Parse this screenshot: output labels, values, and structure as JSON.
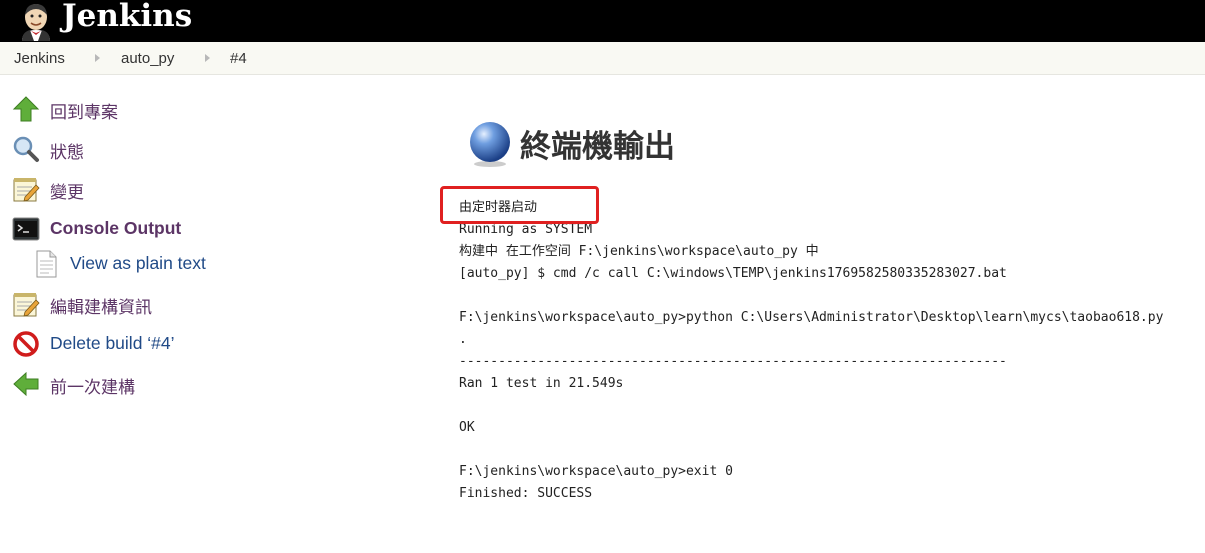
{
  "header": {
    "logo_text": "Jenkins",
    "logo_icon": "jenkins-butler-icon"
  },
  "breadcrumb": {
    "items": [
      "Jenkins",
      "auto_py",
      "#4"
    ]
  },
  "sidebar": {
    "items": [
      {
        "label": "回到專案",
        "icon": "up-arrow-icon"
      },
      {
        "label": "狀態",
        "icon": "search-icon"
      },
      {
        "label": "變更",
        "icon": "notepad-icon"
      },
      {
        "label": "Console Output",
        "icon": "terminal-icon"
      },
      {
        "label": "View as plain text",
        "icon": "document-icon"
      },
      {
        "label": "編輯建構資訊",
        "icon": "notepad-icon"
      },
      {
        "label": "Delete build ‘#4’",
        "icon": "no-entry-icon"
      },
      {
        "label": "前一次建構",
        "icon": "left-arrow-icon"
      }
    ]
  },
  "main": {
    "title": "終端機輸出",
    "title_icon": "blue-ball-icon",
    "console_lines": [
      "由定时器启动",
      "Running as SYSTEM",
      "构建中 在工作空间 F:\\jenkins\\workspace\\auto_py 中",
      "[auto_py] $ cmd /c call C:\\windows\\TEMP\\jenkins1769582580335283027.bat",
      "",
      "F:\\jenkins\\workspace\\auto_py>python C:\\Users\\Administrator\\Desktop\\learn\\mycs\\taobao618.py",
      ".",
      "----------------------------------------------------------------------",
      "Ran 1 test in 21.549s",
      "",
      "OK",
      "",
      "F:\\jenkins\\workspace\\auto_py>exit 0",
      "Finished: SUCCESS"
    ]
  },
  "colors": {
    "header_bg": "#000000",
    "breadcrumb_bg": "#f9f9f3",
    "link": "#204a87",
    "visited_link": "#5c3566",
    "highlight": "#e02020"
  }
}
